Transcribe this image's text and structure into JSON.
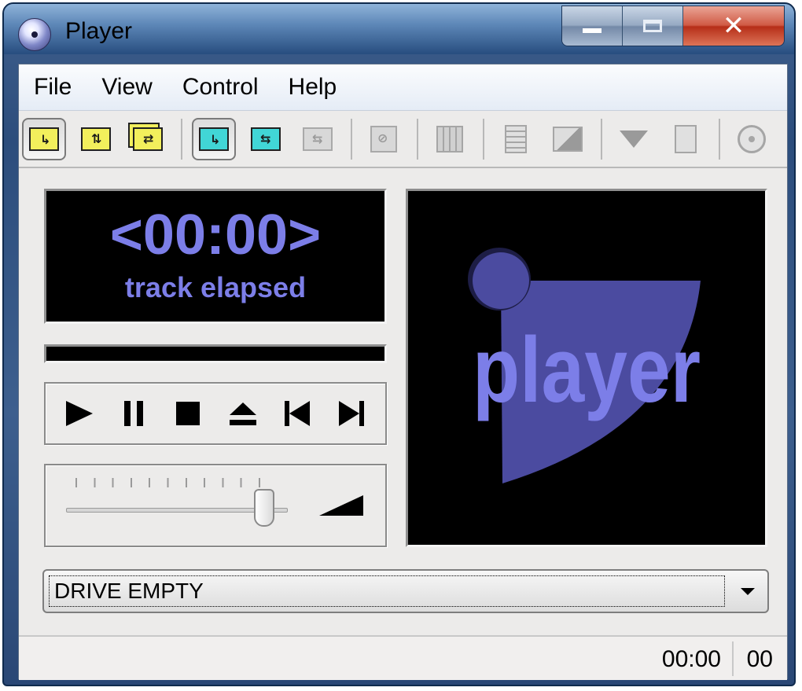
{
  "window": {
    "title": "Player",
    "controls": {
      "minimize": "minimize",
      "maximize": "maximize",
      "close": "close"
    }
  },
  "menu": [
    "File",
    "View",
    "Control",
    "Help"
  ],
  "toolbar": {
    "buttons": [
      {
        "icon": "continuous-play-icon",
        "state": "pressed"
      },
      {
        "icon": "random-order-icon",
        "state": "normal"
      },
      {
        "icon": "repeat-track-icon",
        "state": "normal"
      },
      {
        "icon": "repeat-all-icon",
        "state": "pressed"
      },
      {
        "icon": "intro-play-icon",
        "state": "normal"
      },
      {
        "icon": "edit-playlist-icon",
        "state": "disabled"
      },
      {
        "icon": "disc-info-icon",
        "state": "disabled"
      },
      {
        "icon": "film-icon",
        "state": "disabled"
      },
      {
        "icon": "document-icon",
        "state": "disabled"
      },
      {
        "icon": "picture-icon",
        "state": "disabled"
      },
      {
        "icon": "download-icon",
        "state": "disabled"
      },
      {
        "icon": "save-document-icon",
        "state": "disabled"
      },
      {
        "icon": "cd-preferences-icon",
        "state": "disabled"
      }
    ]
  },
  "display": {
    "time": "<00:00>",
    "mode": "track elapsed",
    "text_color": "#7c7ee8"
  },
  "progress": {
    "value": 0
  },
  "transport": [
    "play",
    "pause",
    "stop",
    "eject",
    "previous",
    "next"
  ],
  "volume": {
    "level": 0.9
  },
  "artwork": {
    "logo_text": "player",
    "colors": {
      "circle": "#4b4ba0",
      "panel": "#4b4ba0",
      "text": "#7c7ee8"
    }
  },
  "drive": {
    "selected": "DRIVE EMPTY"
  },
  "status": {
    "time": "00:00",
    "track": "00"
  }
}
